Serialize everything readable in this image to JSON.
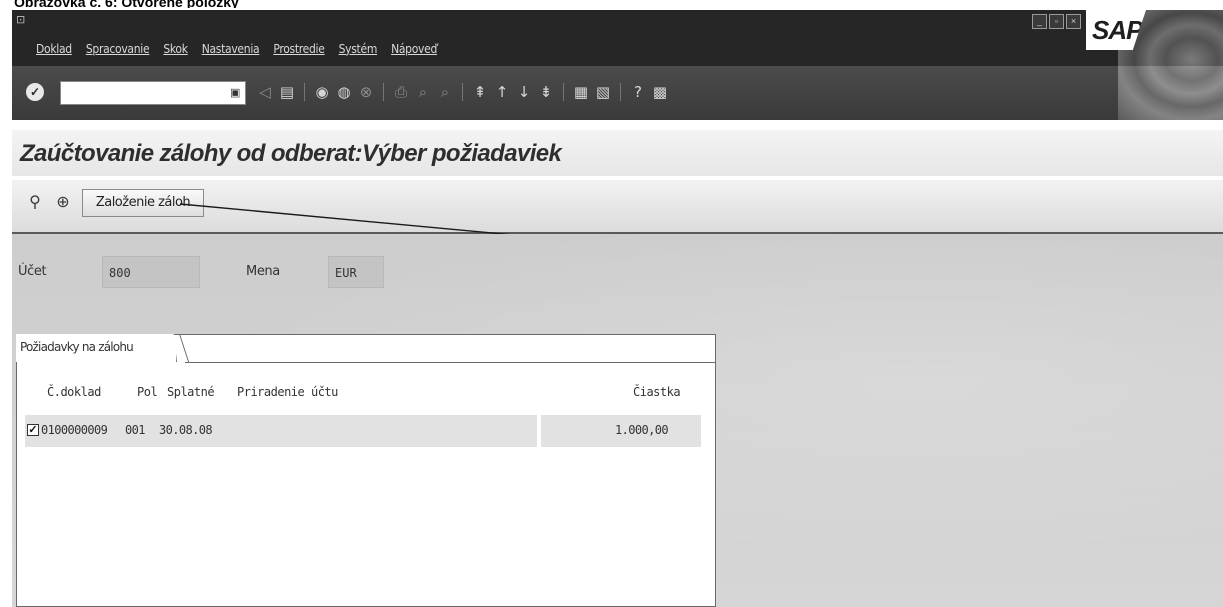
{
  "caption": "Obrazovka č. 6: Otvorené položky",
  "menu": {
    "items": [
      "Doklad",
      "Spracovanie",
      "Skok",
      "Nastavenia",
      "Prostredie",
      "Systém",
      "Nápoveď"
    ]
  },
  "brand": {
    "logo_text": "SAP"
  },
  "page": {
    "title": "Zaúčtovanie zálohy od odberat:Výber požiadaviek"
  },
  "app_toolbar": {
    "create_button_label": "Založenie záloh"
  },
  "header_fields": {
    "account_label": "Účet",
    "account_value": "800",
    "currency_label": "Mena",
    "currency_value": "EUR"
  },
  "panel": {
    "tab_label": "Požiadavky na zálohu",
    "columns": {
      "doc_number": "Č.doklad",
      "item": "Pol",
      "due_date": "Splatné",
      "assignment": "Priradenie účtu",
      "amount": "Čiastka"
    },
    "rows": [
      {
        "checked": true,
        "doc_number": "0100000009",
        "item": "001",
        "due_date": "30.08.08",
        "assignment": "",
        "amount": "1.000,00"
      }
    ]
  }
}
